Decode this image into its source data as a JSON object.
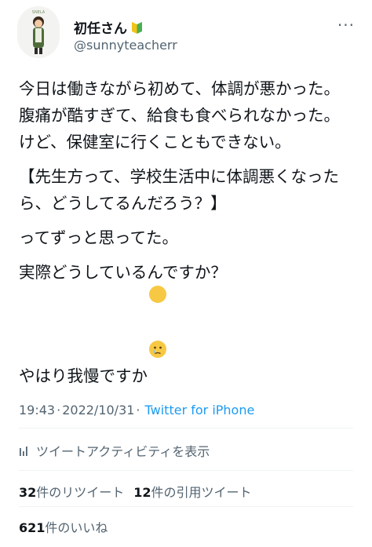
{
  "colors": {
    "text": "#0f1419",
    "secondary": "#536471",
    "accent": "#1d9bf0",
    "divider": "#eff3f4"
  },
  "header": {
    "avatar_icon": "cartoon-teacher-avatar",
    "avatar_label": "SNELA",
    "display_name": "初任さん",
    "badge_icon": "beginner-mark-icon",
    "handle": "@sunnyteacherr",
    "more_icon": "ellipsis-horizontal-icon",
    "more_glyph": "···"
  },
  "tweet": {
    "paragraphs": [
      "今日は働きながら初めて、体調が悪かった。",
      "腹痛が酷すぎて、給食も食べられなかった。",
      "けど、保健室に行くこともできない。",
      "【先生方って、学校生活中に体調悪くなったら、どうしてるんだろう？】",
      "ってずっと思ってた。",
      "実際どうしているんですか？",
      "やはり我慢ですか"
    ],
    "final_emoji": "face-holding-back-tears-emoji"
  },
  "meta": {
    "time": "19:43",
    "separator1": "·",
    "date": "2022/10/31",
    "separator2": "·",
    "source": "Twitter for iPhone"
  },
  "activity": {
    "icon": "bar-chart-icon",
    "label": "ツイートアクティビティを表示"
  },
  "stats": {
    "retweets_count": "32",
    "retweets_label": "件のリツイート",
    "quotes_count": "12",
    "quotes_label": "件の引用ツイート"
  },
  "likes": {
    "count": "621",
    "label": "件のいいね"
  }
}
